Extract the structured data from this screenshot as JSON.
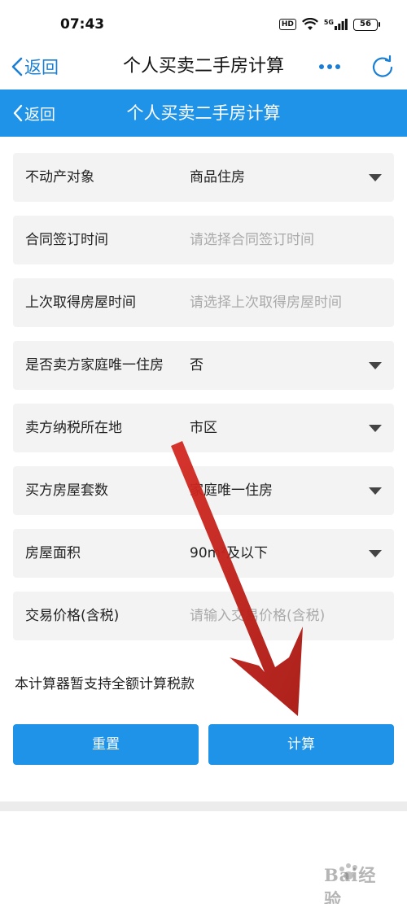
{
  "status_bar": {
    "time": "07:43",
    "hd_label": "HD",
    "network": "5G",
    "battery": "56"
  },
  "top_nav": {
    "back_label": "返回",
    "title": "个人买卖二手房计算"
  },
  "app_header": {
    "back_label": "返回",
    "title": "个人买卖二手房计算"
  },
  "form": {
    "fields": [
      {
        "label": "不动产对象",
        "value": "商品住房",
        "placeholder": "",
        "type": "select"
      },
      {
        "label": "合同签订时间",
        "value": "",
        "placeholder": "请选择合同签订时间",
        "type": "date"
      },
      {
        "label": "上次取得房屋时间",
        "value": "",
        "placeholder": "请选择上次取得房屋时间",
        "type": "date"
      },
      {
        "label": "是否卖方家庭唯一住房",
        "value": "否",
        "placeholder": "",
        "type": "select"
      },
      {
        "label": "卖方纳税所在地",
        "value": "市区",
        "placeholder": "",
        "type": "select"
      },
      {
        "label": "买方房屋套数",
        "value": "家庭唯一住房",
        "placeholder": "",
        "type": "select"
      },
      {
        "label": "房屋面积",
        "value": "90m²及以下",
        "placeholder": "",
        "type": "select"
      },
      {
        "label": "交易价格(含税)",
        "value": "",
        "placeholder": "请输入交易价格(含税)",
        "type": "input"
      }
    ]
  },
  "note": "本计算器暂支持全额计算税款",
  "buttons": {
    "reset": "重置",
    "calculate": "计算"
  },
  "watermark": {
    "text": "Bai经验"
  },
  "colors": {
    "accent": "#1e93e8",
    "link": "#1a7fd4",
    "arrow": "#c8201e",
    "field_bg": "#f3f3f3"
  }
}
